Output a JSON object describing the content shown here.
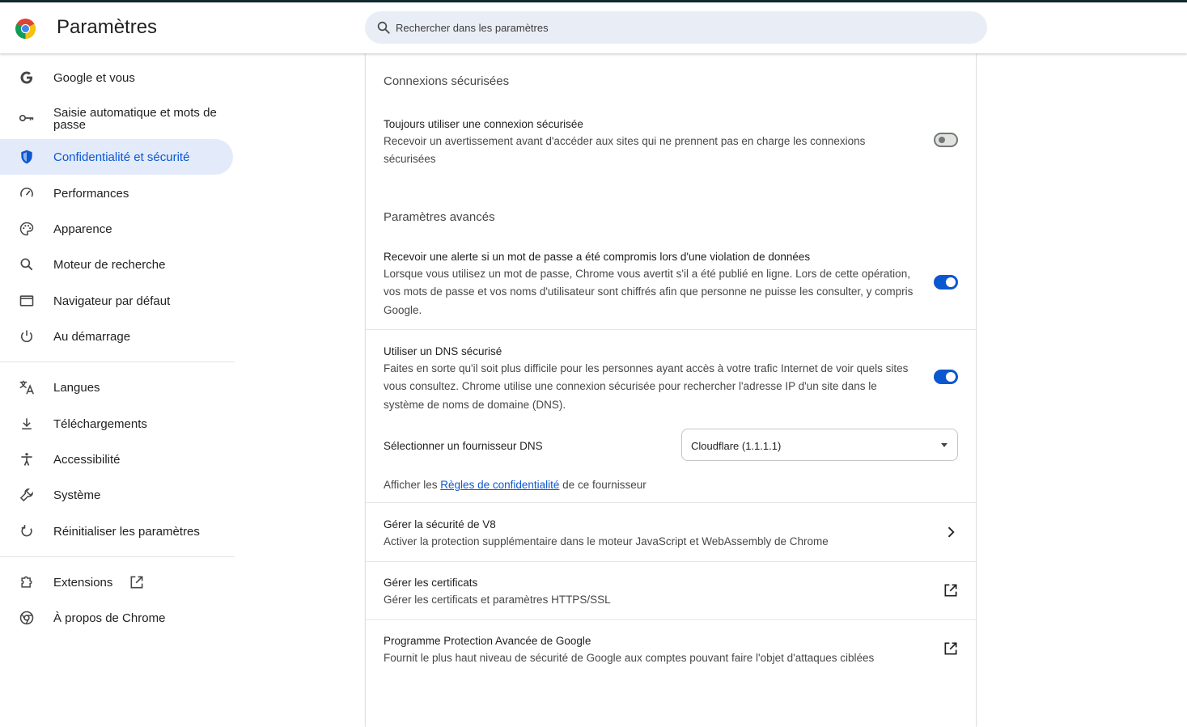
{
  "header": {
    "title": "Paramètres",
    "search_placeholder": "Rechercher dans les paramètres"
  },
  "sidebar": {
    "items": [
      {
        "label": "Google et vous",
        "icon": "google-g-icon"
      },
      {
        "label": "Saisie automatique et mots de passe",
        "icon": "key-icon"
      },
      {
        "label": "Confidentialité et sécurité",
        "icon": "shield-icon",
        "active": true
      },
      {
        "label": "Performances",
        "icon": "speedometer-icon"
      },
      {
        "label": "Apparence",
        "icon": "palette-icon"
      },
      {
        "label": "Moteur de recherche",
        "icon": "search-icon"
      },
      {
        "label": "Navigateur par défaut",
        "icon": "browser-window-icon"
      },
      {
        "label": "Au démarrage",
        "icon": "power-icon"
      },
      {
        "label": "Langues",
        "icon": "translate-icon"
      },
      {
        "label": "Téléchargements",
        "icon": "download-icon"
      },
      {
        "label": "Accessibilité",
        "icon": "accessibility-icon"
      },
      {
        "label": "Système",
        "icon": "wrench-icon"
      },
      {
        "label": "Réinitialiser les paramètres",
        "icon": "reset-icon"
      },
      {
        "label": "Extensions",
        "icon": "puzzle-icon"
      },
      {
        "label": "À propos de Chrome",
        "icon": "chrome-icon"
      }
    ]
  },
  "main": {
    "secure_connections": {
      "title": "Connexions sécurisées",
      "always_https": {
        "title": "Toujours utiliser une connexion sécurisée",
        "desc": "Recevoir un avertissement avant d'accéder aux sites qui ne prennent pas en charge les connexions sécurisées",
        "enabled": false
      }
    },
    "advanced": {
      "title": "Paramètres avancés",
      "password_leak": {
        "title": "Recevoir une alerte si un mot de passe a été compromis lors d'une violation de données",
        "desc": "Lorsque vous utilisez un mot de passe, Chrome vous avertit s'il a été publié en ligne. Lors de cette opération, vos mots de passe et vos noms d'utilisateur sont chiffrés afin que personne ne puisse les consulter, y compris Google.",
        "enabled": true
      },
      "secure_dns": {
        "title": "Utiliser un DNS sécurisé",
        "desc": "Faites en sorte qu'il soit plus difficile pour les personnes ayant accès à votre trafic Internet de voir quels sites vous consultez. Chrome utilise une connexion sécurisée pour rechercher l'adresse IP d'un site dans le système de noms de domaine (DNS).",
        "enabled": true,
        "provider_label": "Sélectionner un fournisseur DNS",
        "provider_value": "Cloudflare (1.1.1.1)",
        "policy_prefix": "Afficher les",
        "policy_link": "Règles de confidentialité",
        "policy_suffix": "de ce fournisseur"
      },
      "v8": {
        "title": "Gérer la sécurité de V8",
        "desc": "Activer la protection supplémentaire dans le moteur JavaScript et WebAssembly de Chrome"
      },
      "certificates": {
        "title": "Gérer les certificats",
        "desc": "Gérer les certificats et paramètres HTTPS/SSL"
      },
      "advanced_protection": {
        "title": "Programme Protection Avancée de Google",
        "desc": "Fournit le plus haut niveau de sécurité de Google aux comptes pouvant faire l'objet d'attaques ciblées"
      }
    }
  },
  "colors": {
    "accent": "#0b57d0",
    "active_bg": "#e3ebfa",
    "search_bg": "#e9eef6"
  }
}
